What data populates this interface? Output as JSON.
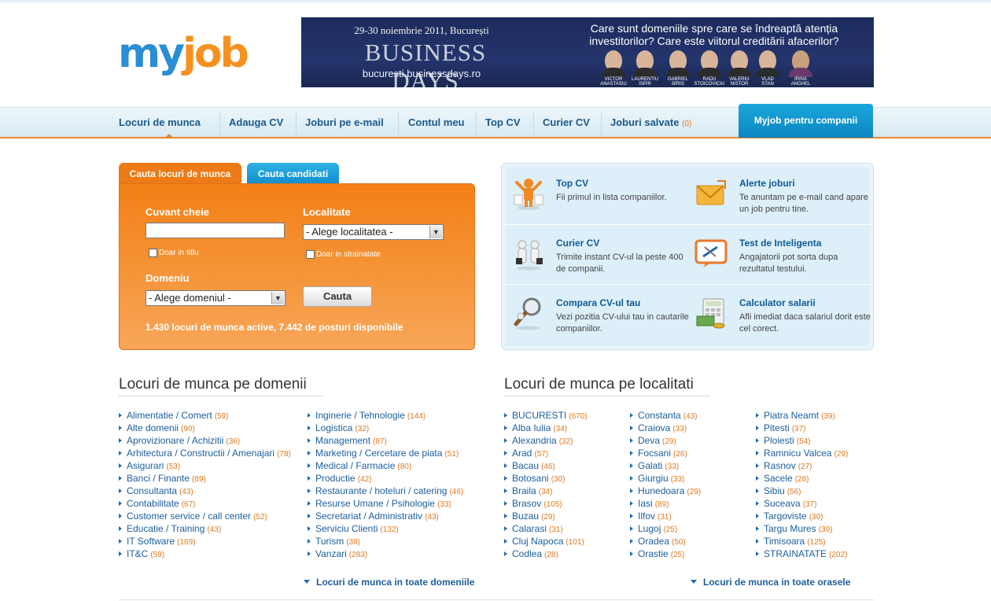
{
  "logo": {
    "part1": "my",
    "part2": "job"
  },
  "banner": {
    "date": "29-30 noiembrie 2011, București",
    "title": "BUSINESS DAYS",
    "url": "bucuresti.businessdays.ro",
    "question": "Care sunt domeniile spre care se îndreaptă atenția investitorilor? Care este viitorul creditării afacerilor?",
    "speakers": [
      {
        "l1": "VICTOR",
        "l2": "ANASTASIU"
      },
      {
        "l1": "LAURENTIU",
        "l2": "ISPIR"
      },
      {
        "l1": "GABRIEL",
        "l2": "BIRIS"
      },
      {
        "l1": "RADU",
        "l2": "STOICOVICIU"
      },
      {
        "l1": "VALERIU",
        "l2": "NISTOR"
      },
      {
        "l1": "VLAD",
        "l2": "STAN"
      },
      {
        "l1": "IRINA",
        "l2": "ANGHEL"
      }
    ]
  },
  "nav": {
    "items": [
      "Locuri de munca",
      "Adauga CV",
      "Joburi pe e-mail",
      "Contul meu",
      "Top CV",
      "Curier CV",
      "Joburi salvate"
    ],
    "saved_count": "(0)",
    "companies": "Myjob pentru companii"
  },
  "search": {
    "tab_jobs": "Cauta locuri de munca",
    "tab_candidates": "Cauta candidati",
    "keyword_label": "Cuvant cheie",
    "keyword_value": "",
    "location_label": "Localitate",
    "location_value": "- Alege localitatea -",
    "only_title": "Doar in titlu",
    "only_abroad": "Doar in strainatate",
    "domain_label": "Domeniu",
    "domain_value": "- Alege domeniul -",
    "button": "Cauta",
    "stats": "1.430 locuri de munca active, 7.442 de posturi disponibile"
  },
  "features": [
    {
      "title": "Top CV",
      "desc": "Fii primul in lista companiilor.",
      "icon": "top-cv-icon"
    },
    {
      "title": "Alerte joburi",
      "desc": "Te anuntam pe e-mail cand apare un job pentru tine.",
      "icon": "envelope-icon"
    },
    {
      "title": "Curier CV",
      "desc": "Trimite instant CV-ul la peste 400 de companii.",
      "icon": "courier-icon"
    },
    {
      "title": "Test de Inteligenta",
      "desc": "Angajatorii pot sorta dupa rezultatul testului.",
      "icon": "test-icon"
    },
    {
      "title": "Compara CV-ul tau",
      "desc": "Vezi pozitia CV-ului tau in cautarile companiilor.",
      "icon": "magnifier-icon"
    },
    {
      "title": "Calculator salarii",
      "desc": "Afli imediat daca salariul dorit este cel corect.",
      "icon": "calculator-icon"
    }
  ],
  "domains_title": "Locuri de munca pe domenii",
  "locations_title": "Locuri de munca pe localitati",
  "domains_col1": [
    {
      "t": "Alimentatie / Comert",
      "c": "(59)"
    },
    {
      "t": "Alte domenii",
      "c": "(90)"
    },
    {
      "t": "Aprovizionare / Achizitii",
      "c": "(36)"
    },
    {
      "t": "Arhitectura / Constructii / Amenajari",
      "c": "(78)"
    },
    {
      "t": "Asigurari",
      "c": "(53)"
    },
    {
      "t": "Banci / Finante",
      "c": "(89)"
    },
    {
      "t": "Consultanta",
      "c": "(43)"
    },
    {
      "t": "Contabilitate",
      "c": "(67)"
    },
    {
      "t": "Customer service / call center",
      "c": "(52)"
    },
    {
      "t": "Educatie / Training",
      "c": "(43)"
    },
    {
      "t": "IT Software",
      "c": "(169)"
    },
    {
      "t": "IT&C",
      "c": "(59)"
    }
  ],
  "domains_col2": [
    {
      "t": "Inginerie / Tehnologie",
      "c": "(144)"
    },
    {
      "t": "Logistica",
      "c": "(32)"
    },
    {
      "t": "Management",
      "c": "(87)"
    },
    {
      "t": "Marketing / Cercetare de piata",
      "c": "(51)"
    },
    {
      "t": "Medical / Farmacie",
      "c": "(80)"
    },
    {
      "t": "Productie",
      "c": "(42)"
    },
    {
      "t": "Restaurante / hoteluri / catering",
      "c": "(46)"
    },
    {
      "t": "Resurse Umane / Psihologie",
      "c": "(33)"
    },
    {
      "t": "Secretariat / Administrativ",
      "c": "(43)"
    },
    {
      "t": "Serviciu Clienti",
      "c": "(132)"
    },
    {
      "t": "Turism",
      "c": "(38)"
    },
    {
      "t": "Vanzari",
      "c": "(283)"
    }
  ],
  "loc_col1": [
    {
      "t": "BUCURESTI",
      "c": "(670)"
    },
    {
      "t": "Alba Iulia",
      "c": "(34)"
    },
    {
      "t": "Alexandria",
      "c": "(32)"
    },
    {
      "t": "Arad",
      "c": "(57)"
    },
    {
      "t": "Bacau",
      "c": "(46)"
    },
    {
      "t": "Botosani",
      "c": "(30)"
    },
    {
      "t": "Braila",
      "c": "(34)"
    },
    {
      "t": "Brasov",
      "c": "(105)"
    },
    {
      "t": "Buzau",
      "c": "(29)"
    },
    {
      "t": "Calarasi",
      "c": "(31)"
    },
    {
      "t": "Cluj Napoca",
      "c": "(101)"
    },
    {
      "t": "Codlea",
      "c": "(28)"
    }
  ],
  "loc_col2": [
    {
      "t": "Constanta",
      "c": "(43)"
    },
    {
      "t": "Craiova",
      "c": "(33)"
    },
    {
      "t": "Deva",
      "c": "(29)"
    },
    {
      "t": "Focsani",
      "c": "(26)"
    },
    {
      "t": "Galati",
      "c": "(33)"
    },
    {
      "t": "Giurgiu",
      "c": "(33)"
    },
    {
      "t": "Hunedoara",
      "c": "(29)"
    },
    {
      "t": "Iasi",
      "c": "(89)"
    },
    {
      "t": "Ilfov",
      "c": "(31)"
    },
    {
      "t": "Lugoj",
      "c": "(25)"
    },
    {
      "t": "Oradea",
      "c": "(50)"
    },
    {
      "t": "Orastie",
      "c": "(25)"
    }
  ],
  "loc_col3": [
    {
      "t": "Piatra Neamt",
      "c": "(39)"
    },
    {
      "t": "Pitesti",
      "c": "(37)"
    },
    {
      "t": "Ploiesti",
      "c": "(54)"
    },
    {
      "t": "Ramnicu Valcea",
      "c": "(29)"
    },
    {
      "t": "Rasnov",
      "c": "(27)"
    },
    {
      "t": "Sacele",
      "c": "(28)"
    },
    {
      "t": "Sibiu",
      "c": "(56)"
    },
    {
      "t": "Suceava",
      "c": "(37)"
    },
    {
      "t": "Targoviste",
      "c": "(30)"
    },
    {
      "t": "Targu Mures",
      "c": "(39)"
    },
    {
      "t": "Timisoara",
      "c": "(125)"
    },
    {
      "t": "STRAINATATE",
      "c": "(202)"
    }
  ],
  "more_domains": "Locuri de munca in toate domeniile",
  "more_locations": "Locuri de munca in toate orasele"
}
